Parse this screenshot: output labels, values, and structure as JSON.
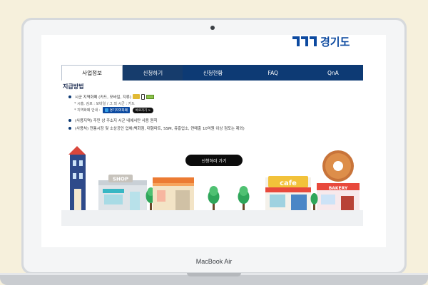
{
  "device": {
    "model_label": "MacBook Air"
  },
  "site": {
    "logo_text": "경기도"
  },
  "nav": {
    "tabs": [
      {
        "label": "사업정보",
        "active": true
      },
      {
        "label": "신청하기",
        "active": false
      },
      {
        "label": "신청현황",
        "active": false
      },
      {
        "label": "FAQ",
        "active": false
      },
      {
        "label": "QnA",
        "active": false
      }
    ]
  },
  "content": {
    "section_title": "지급방법",
    "item1": "시군 지역화폐 (카드, 모바일, 지류)",
    "item1_sub1": "* 시흥, 김포 : 모바일 / 그 외 시군 : 카드",
    "item1_sub2": "* 지역화폐 안내 :",
    "item1_badge": "경기지역화폐",
    "item1_button": "바로가기 >",
    "item2": "(사용지역) 주민 상 주소지 시군 내에서만 사용 원칙",
    "item3": "(사용처) 전통시장 및 소상공인 업체(백화점, 대형마트, SSM, 유흥업소, 연매출 10억원 이상 점포는 제외)"
  },
  "cta": {
    "label": "신청하러 가기"
  },
  "illustration": {
    "signs": {
      "shop": "SHOP",
      "cafe": "cafe",
      "bakery": "BAKERY"
    },
    "colors": {
      "navy": "#0d3a74",
      "red": "#e8493c",
      "donut": "#c8743a"
    }
  }
}
